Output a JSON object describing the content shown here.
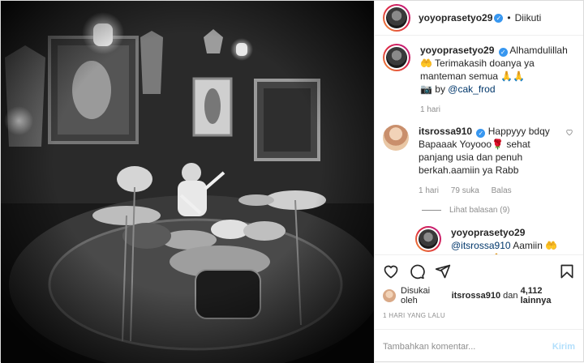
{
  "header": {
    "username": "yoyoprasetyo29",
    "separator": "•",
    "follow_status": "Diikuti"
  },
  "caption": {
    "username": "yoyoprasetyo29",
    "text": "Alhamdulillah 🤲 Terimakasih doanya ya manteman semua 🙏🙏",
    "credit_prefix": "📷 by ",
    "credit_mention": "@cak_frod",
    "time": "1 hari"
  },
  "comment1": {
    "username": "itsrossa910",
    "text": "Happyyy bdqy Bapaaak Yoyooo🌹 sehat panjang usia dan penuh berkah.aamiin ya Rabb",
    "time": "1 hari",
    "likes": "79 suka",
    "reply_label": "Balas",
    "view_replies": "Lihat balasan (9)"
  },
  "reply1": {
    "username": "yoyoprasetyo29",
    "mention": "@itsrossa910",
    "text": " Aamiin 🤲 mksh bu 🙏"
  },
  "likes": {
    "prefix": "Disukai oleh ",
    "user": "itsrossa910",
    "middle": " dan ",
    "count": "4,112 lainnya"
  },
  "date": "1 HARI YANG LALU",
  "add_comment": {
    "placeholder": "Tambahkan komentar...",
    "submit_label": "Kirim"
  },
  "icons": {
    "like": "heart-icon",
    "comment": "comment-icon",
    "share": "share-icon",
    "save": "bookmark-icon",
    "comment_like": "heart-icon"
  },
  "colors": {
    "link": "#00376b",
    "verified": "#3897f0",
    "muted": "#8e8e8e",
    "submit_disabled": "#b2dffc"
  }
}
